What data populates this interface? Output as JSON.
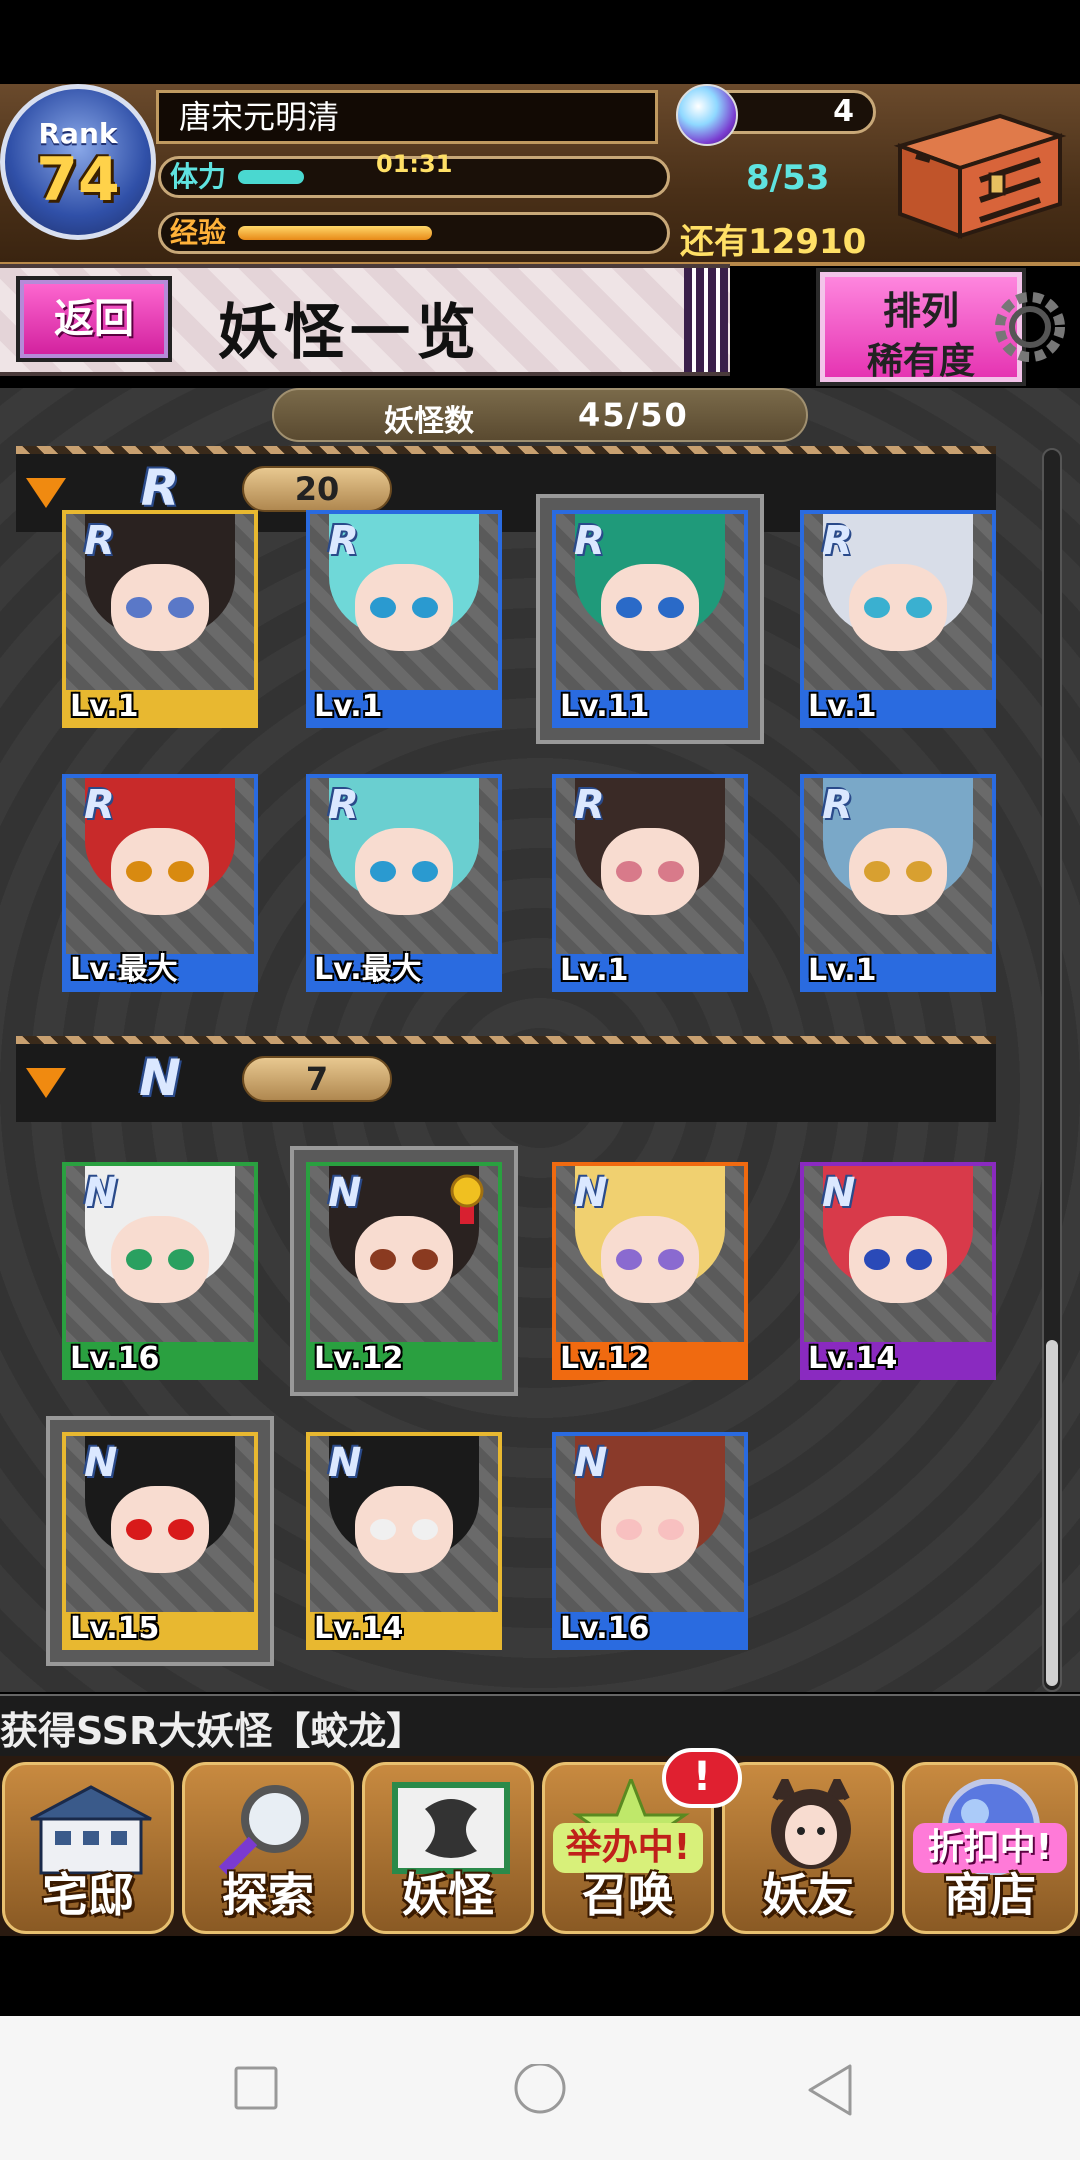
{
  "header": {
    "rank_label": "Rank",
    "rank_value": "74",
    "player_name": "唐宋元明清",
    "stamina_label": "体力",
    "stamina_timer": "01:31",
    "stamina_fraction": 0.2,
    "stamina_count": "8/53",
    "exp_label": "经验",
    "exp_fraction": 0.4,
    "exp_remaining": "还有12910",
    "gem_count": "4",
    "gem_icon": "crystal-orb-icon",
    "chest_icon": "treasure-chest-icon"
  },
  "title_bar": {
    "back_label": "返回",
    "title": "妖怪一览",
    "sort_label": "排列",
    "sort_value": "稀有度"
  },
  "monster_count": {
    "label": "妖怪数",
    "value": "45/50"
  },
  "sections": [
    {
      "rarity": "R",
      "count": "20",
      "cards": [
        {
          "level": "Lv.1",
          "frame_color": "#e8b830",
          "hair": "#2a2220",
          "eyes": "#5a78c8"
        },
        {
          "level": "Lv.1",
          "frame_color": "#2a6be0",
          "hair": "#6fd8d8",
          "eyes": "#2a9ad0"
        },
        {
          "level": "Lv.11",
          "frame_color": "#2a6be0",
          "hair": "#1f9a7a",
          "eyes": "#2a6ac8"
        },
        {
          "level": "Lv.1",
          "frame_color": "#2a6be0",
          "hair": "#d8dde8",
          "eyes": "#3ab0d0"
        },
        {
          "level": "Lv.最大",
          "frame_color": "#2a6be0",
          "hair": "#c82a2a",
          "eyes": "#d88a10"
        },
        {
          "level": "Lv.最大",
          "frame_color": "#2a6be0",
          "hair": "#6acfd0",
          "eyes": "#2a9ad0"
        },
        {
          "level": "Lv.1",
          "frame_color": "#2a6be0",
          "hair": "#3a2a26",
          "eyes": "#d87a8a"
        },
        {
          "level": "Lv.1",
          "frame_color": "#2a6be0",
          "hair": "#7aa8c8",
          "eyes": "#d8a030"
        }
      ]
    },
    {
      "rarity": "N",
      "count": "7",
      "cards": [
        {
          "level": "Lv.16",
          "frame_color": "#2aa040",
          "hair": "#eeeeee",
          "eyes": "#2aa060"
        },
        {
          "level": "Lv.12",
          "frame_color": "#2aa040",
          "hair": "#2a2220",
          "eyes": "#8a3a20"
        },
        {
          "level": "Lv.12",
          "frame_color": "#f06a10",
          "hair": "#f0d070",
          "eyes": "#8a6ad0"
        },
        {
          "level": "Lv.14",
          "frame_color": "#8a2ac0",
          "hair": "#d83a4a",
          "eyes": "#2a4ab8"
        },
        {
          "level": "Lv.15",
          "frame_color": "#e8b830",
          "hair": "#1a1a1a",
          "eyes": "#d81a1a"
        },
        {
          "level": "Lv.14",
          "frame_color": "#e8b830",
          "hair": "#1a1a1a",
          "eyes": "#f0f0f0"
        },
        {
          "level": "Lv.16",
          "frame_color": "#2a6be0",
          "hair": "#8a3a2a",
          "eyes": "#f8c0c0"
        }
      ]
    }
  ],
  "ticker": {
    "text": "获得SSR大妖怪【蛟龙】"
  },
  "nav": {
    "items": [
      {
        "label": "宅邸",
        "icon": "house-icon"
      },
      {
        "label": "探索",
        "icon": "magnifier-icon"
      },
      {
        "label": "妖怪",
        "icon": "scroll-icon"
      },
      {
        "label": "召唤",
        "icon": "summon-star-icon",
        "banner": "举办中!"
      },
      {
        "label": "妖友",
        "icon": "friend-icon"
      },
      {
        "label": "商店",
        "icon": "shop-orb-icon",
        "banner": "折扣中!"
      }
    ],
    "notification": "!"
  },
  "system_nav": {
    "recent_icon": "square-icon",
    "home_icon": "circle-icon",
    "back_icon": "triangle-back-icon"
  },
  "colors": {
    "accent_pink": "#e430b0",
    "stamina": "#5fe3e0",
    "exp": "#ffb23a",
    "gold_text": "#ffe066"
  }
}
